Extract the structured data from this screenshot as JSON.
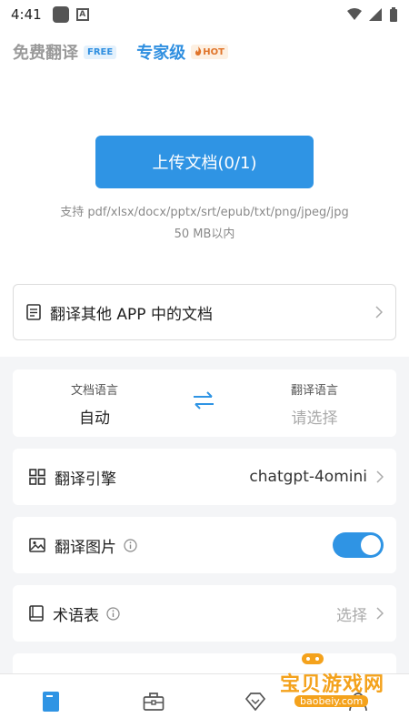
{
  "status": {
    "time": "4:41"
  },
  "tabs": {
    "free": {
      "label": "免费翻译",
      "badge": "FREE"
    },
    "pro": {
      "label": "专家级",
      "badge": "HOT"
    }
  },
  "upload": {
    "button_label": "上传文档(0/1)",
    "formats": "支持 pdf/xlsx/docx/pptx/srt/epub/txt/png/jpeg/jpg",
    "size_limit": "50 MB以内"
  },
  "other_app": {
    "label": "翻译其他 APP 中的文档"
  },
  "languages": {
    "source_title": "文档语言",
    "source_value": "自动",
    "target_title": "翻译语言",
    "target_placeholder": "请选择"
  },
  "engine": {
    "label": "翻译引擎",
    "value": "chatgpt-4omini"
  },
  "translate_images": {
    "label": "翻译图片",
    "enabled": true
  },
  "glossary": {
    "label": "术语表",
    "value": "选择"
  },
  "watermark": {
    "text": "宝贝游戏网",
    "url": "baobeiy.com"
  },
  "colors": {
    "accent": "#2f94e4",
    "hot": "#e0742a",
    "watermark": "#f4a21c"
  }
}
